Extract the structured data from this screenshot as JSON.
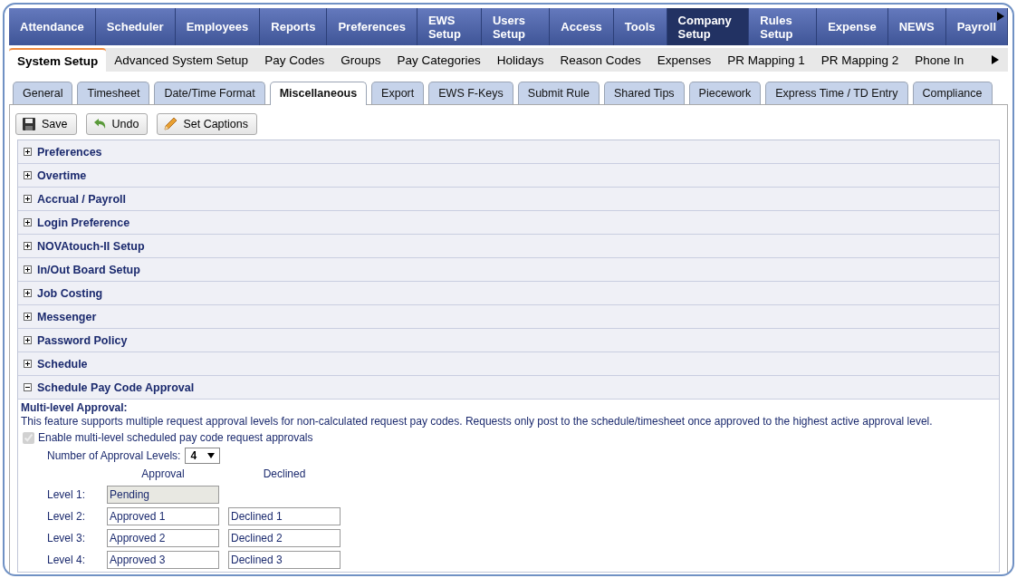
{
  "main_nav": {
    "items": [
      {
        "label": "Attendance",
        "selected": false
      },
      {
        "label": "Scheduler",
        "selected": false
      },
      {
        "label": "Employees",
        "selected": false
      },
      {
        "label": "Reports",
        "selected": false
      },
      {
        "label": "Preferences",
        "selected": false
      },
      {
        "label": "EWS Setup",
        "selected": false
      },
      {
        "label": "Users Setup",
        "selected": false
      },
      {
        "label": "Access",
        "selected": false
      },
      {
        "label": "Tools",
        "selected": false
      },
      {
        "label": "Company Setup",
        "selected": true
      },
      {
        "label": "Rules Setup",
        "selected": false
      },
      {
        "label": "Expense",
        "selected": false
      },
      {
        "label": "NEWS",
        "selected": false
      },
      {
        "label": "Payroll",
        "selected": false
      }
    ]
  },
  "sub_nav": {
    "items": [
      {
        "label": "System Setup",
        "selected": true
      },
      {
        "label": "Advanced System Setup",
        "selected": false
      },
      {
        "label": "Pay Codes",
        "selected": false
      },
      {
        "label": "Groups",
        "selected": false
      },
      {
        "label": "Pay Categories",
        "selected": false
      },
      {
        "label": "Holidays",
        "selected": false
      },
      {
        "label": "Reason Codes",
        "selected": false
      },
      {
        "label": "Expenses",
        "selected": false
      },
      {
        "label": "PR Mapping 1",
        "selected": false
      },
      {
        "label": "PR Mapping 2",
        "selected": false
      },
      {
        "label": "Phone In",
        "selected": false
      }
    ]
  },
  "tabs": [
    {
      "label": "General",
      "selected": false
    },
    {
      "label": "Timesheet",
      "selected": false
    },
    {
      "label": "Date/Time Format",
      "selected": false
    },
    {
      "label": "Miscellaneous",
      "selected": true
    },
    {
      "label": "Export",
      "selected": false
    },
    {
      "label": "EWS F-Keys",
      "selected": false
    },
    {
      "label": "Submit Rule",
      "selected": false
    },
    {
      "label": "Shared Tips",
      "selected": false
    },
    {
      "label": "Piecework",
      "selected": false
    },
    {
      "label": "Express Time / TD Entry",
      "selected": false
    },
    {
      "label": "Compliance",
      "selected": false
    }
  ],
  "toolbar": [
    {
      "label": "Save",
      "kind": "save"
    },
    {
      "label": "Undo",
      "kind": "undo"
    },
    {
      "label": "Set Captions",
      "kind": "captions"
    }
  ],
  "sections": [
    {
      "label": "Preferences",
      "expanded": false
    },
    {
      "label": "Overtime",
      "expanded": false
    },
    {
      "label": "Accrual / Payroll",
      "expanded": false
    },
    {
      "label": "Login Preference",
      "expanded": false
    },
    {
      "label": "NOVAtouch-II Setup",
      "expanded": false
    },
    {
      "label": "In/Out Board Setup",
      "expanded": false
    },
    {
      "label": "Job Costing",
      "expanded": false
    },
    {
      "label": "Messenger",
      "expanded": false
    },
    {
      "label": "Password Policy",
      "expanded": false
    },
    {
      "label": "Schedule",
      "expanded": false
    },
    {
      "label": "Schedule Pay Code Approval",
      "expanded": true
    }
  ],
  "approval": {
    "heading": "Multi-level Approval:",
    "description": "This feature supports multiple request approval levels for non-calculated request pay codes. Requests only post to the schedule/timesheet once approved to the highest active approval level.",
    "enable": {
      "label": "Enable multi-level scheduled pay code request approvals",
      "checked": true,
      "disabled": true
    },
    "levels_label": "Number of Approval Levels:",
    "levels_value": "4",
    "column_headers": [
      "Approval",
      "Declined"
    ],
    "levels": [
      {
        "label": "Level 1:",
        "approval": "Pending",
        "approval_disabled": true
      },
      {
        "label": "Level 2:",
        "approval": "Approved 1",
        "declined": "Declined 1",
        "approval_disabled": false
      },
      {
        "label": "Level 3:",
        "approval": "Approved 2",
        "declined": "Declined 2",
        "approval_disabled": false
      },
      {
        "label": "Level 4:",
        "approval": "Approved 3",
        "declined": "Declined 3",
        "approval_disabled": false
      }
    ]
  }
}
